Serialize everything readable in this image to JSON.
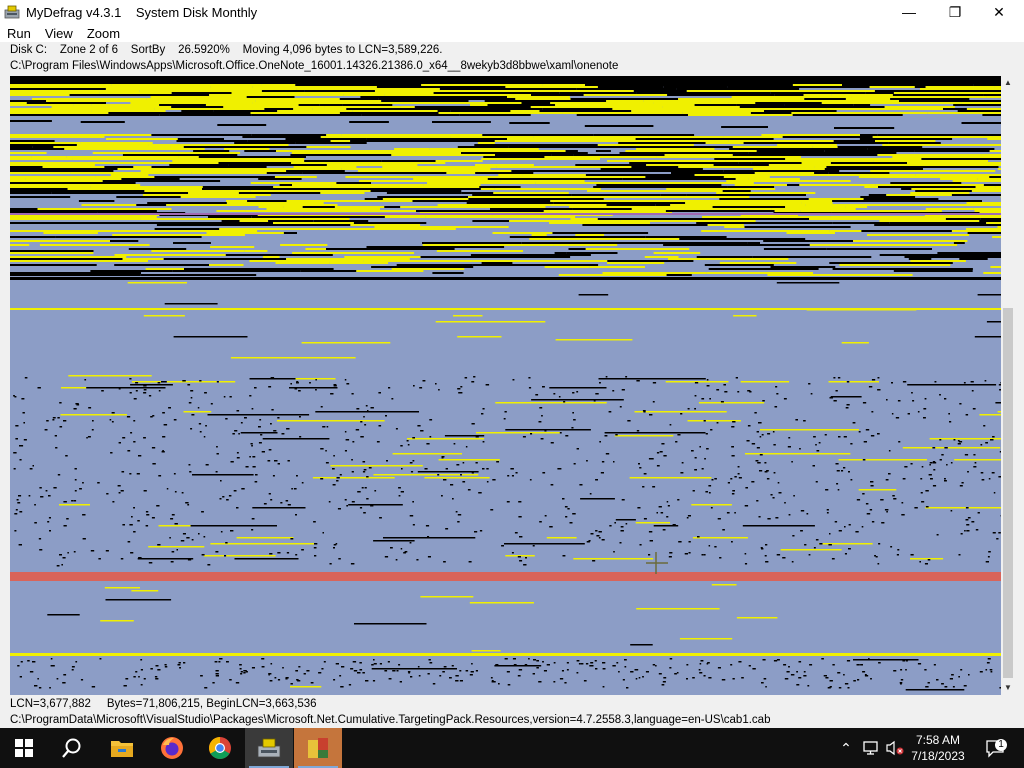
{
  "window": {
    "title": "MyDefrag v4.3.1    System Disk Monthly",
    "minimize_glyph": "—",
    "maximize_glyph": "❐",
    "close_glyph": "✕"
  },
  "menu": {
    "items": [
      {
        "label": "Run"
      },
      {
        "label": "View"
      },
      {
        "label": "Zoom"
      }
    ]
  },
  "status_top": {
    "line1": "Disk C:    Zone 2 of 6    SortBy    26.5920%    Moving 4,096 bytes to LCN=3,589,226.",
    "line2": "C:\\Program Files\\WindowsApps\\Microsoft.Office.OneNote_16001.14326.21386.0_x64__8wekyb3d8bbwe\\xaml\\onenote"
  },
  "status_bottom": {
    "line1": "LCN=3,677,882     Bytes=71,806,215, BeginLCN=3,663,536",
    "line2": "C:\\ProgramData\\Microsoft\\VisualStudio\\Packages\\Microsoft.Net.Cumulative.TargetingPack.Resources,version=4.7.2558.3,language=en-US\\cab1.cab"
  },
  "diskmap": {
    "colors": {
      "empty": "#8c9dc6",
      "fragmented": "#000000",
      "unfragmented": "#f0f000",
      "unmovable": "#d9645a",
      "mft": "#a06ab4"
    }
  },
  "taskbar": {
    "items": [
      {
        "name": "start",
        "icon": "windows-icon"
      },
      {
        "name": "search",
        "icon": "search-icon"
      },
      {
        "name": "file-explorer",
        "icon": "folder-icon"
      },
      {
        "name": "firefox",
        "icon": "firefox-icon"
      },
      {
        "name": "chrome",
        "icon": "chrome-icon"
      },
      {
        "name": "mydefrag",
        "icon": "mydefrag-icon"
      },
      {
        "name": "app",
        "icon": "app-icon"
      }
    ],
    "tray": {
      "chevron": "⌃",
      "time": "7:58 AM",
      "date": "7/18/2023",
      "notification_count": "1"
    }
  }
}
